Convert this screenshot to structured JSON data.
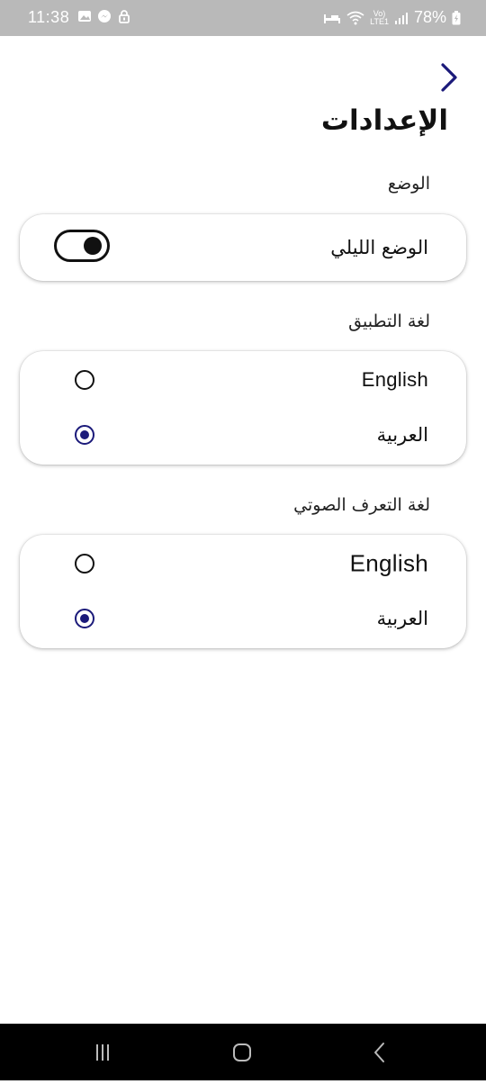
{
  "status_bar": {
    "time": "11:38",
    "battery": "78%",
    "network_top": "Vo)",
    "network_bottom": "LTE1"
  },
  "header": {
    "title": "الإعدادات",
    "back_icon": "chevron-right-icon"
  },
  "mode_section": {
    "label": "الوضع",
    "night_mode": {
      "label": "الوضع الليلي",
      "enabled": true
    }
  },
  "app_language": {
    "label": "لغة التطبيق",
    "options": [
      {
        "label": "English",
        "selected": false
      },
      {
        "label": "العربية",
        "selected": true
      }
    ]
  },
  "voice_language": {
    "label": "لغة التعرف الصوتي",
    "options": [
      {
        "label": "English",
        "selected": false
      },
      {
        "label": "العربية",
        "selected": true
      }
    ]
  },
  "nav_bar": {
    "recents_icon": "recent-apps-icon",
    "home_icon": "home-icon",
    "back_icon": "back-icon"
  },
  "colors": {
    "accent": "#1b1a7a",
    "status_bar": "#b9b9b9",
    "nav_bar": "#000000"
  }
}
